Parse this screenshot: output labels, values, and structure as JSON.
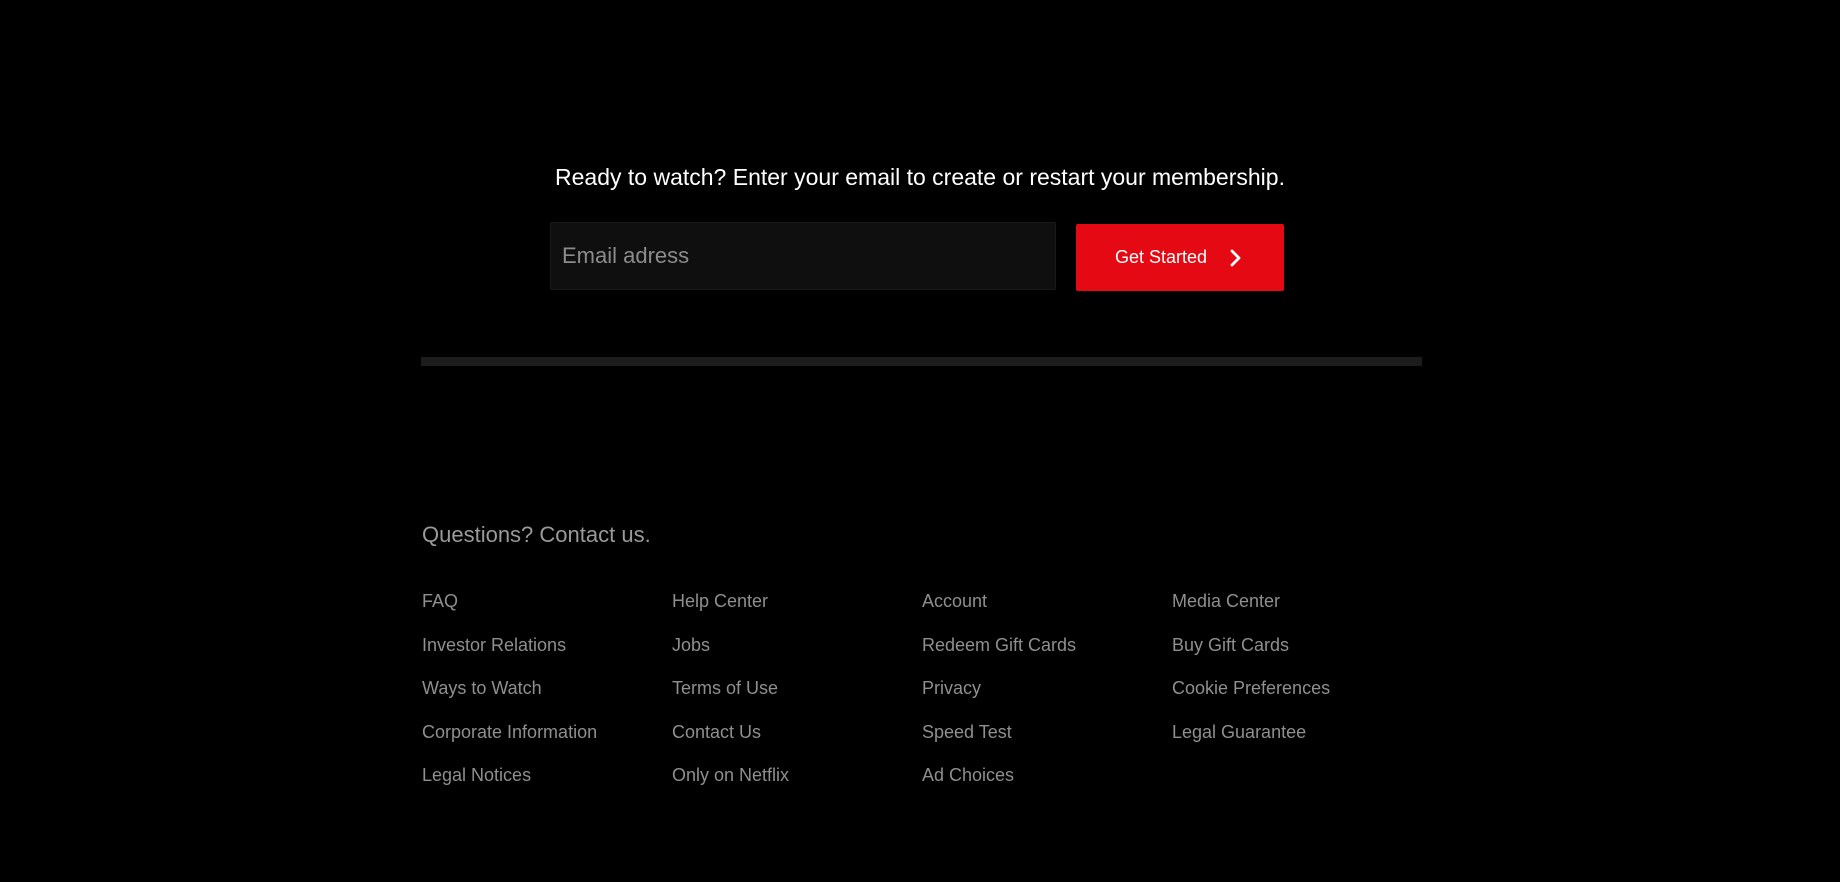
{
  "cta": {
    "heading": "Ready to watch? Enter your email to create or restart your membership.",
    "email_placeholder": "Email adress",
    "button_label": "Get Started",
    "button_icon": "chevron-right-icon",
    "accent_color": "#e50914"
  },
  "footer": {
    "contact_text": "Questions? Contact us.",
    "columns": [
      {
        "links": [
          "FAQ",
          "Investor Relations",
          "Ways to Watch",
          "Corporate Information",
          "Legal Notices"
        ]
      },
      {
        "links": [
          "Help Center",
          "Jobs",
          "Terms of Use",
          "Contact Us",
          "Only on Netflix"
        ]
      },
      {
        "links": [
          "Account",
          "Redeem Gift Cards",
          "Privacy",
          "Speed Test",
          "Ad Choices"
        ]
      },
      {
        "links": [
          "Media Center",
          "Buy Gift Cards",
          "Cookie Preferences",
          "Legal Guarantee"
        ]
      }
    ]
  }
}
